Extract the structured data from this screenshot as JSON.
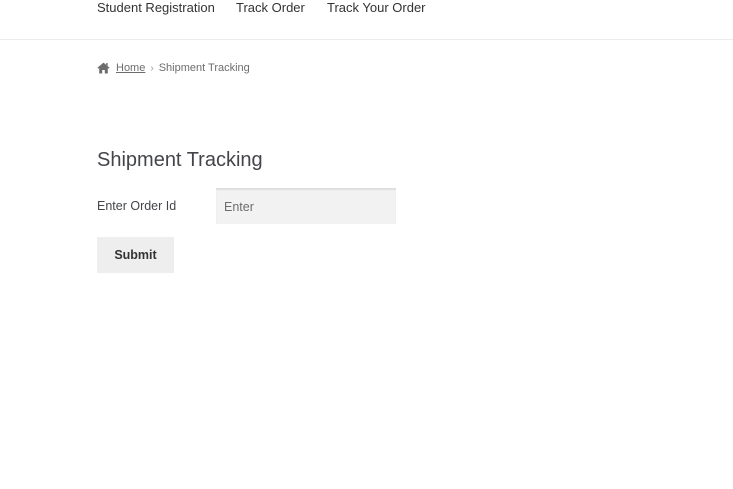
{
  "nav": {
    "items": [
      {
        "label": "Student Registration"
      },
      {
        "label": "Track Order"
      },
      {
        "label": "Track Your Order"
      }
    ]
  },
  "breadcrumb": {
    "home_icon": "home-icon",
    "home_label": "Home",
    "separator": "›",
    "current": "Shipment Tracking"
  },
  "main": {
    "title": "Shipment Tracking",
    "form": {
      "order_label": "Enter Order Id",
      "order_placeholder": "Enter",
      "order_value": "",
      "submit_label": "Submit"
    }
  }
}
